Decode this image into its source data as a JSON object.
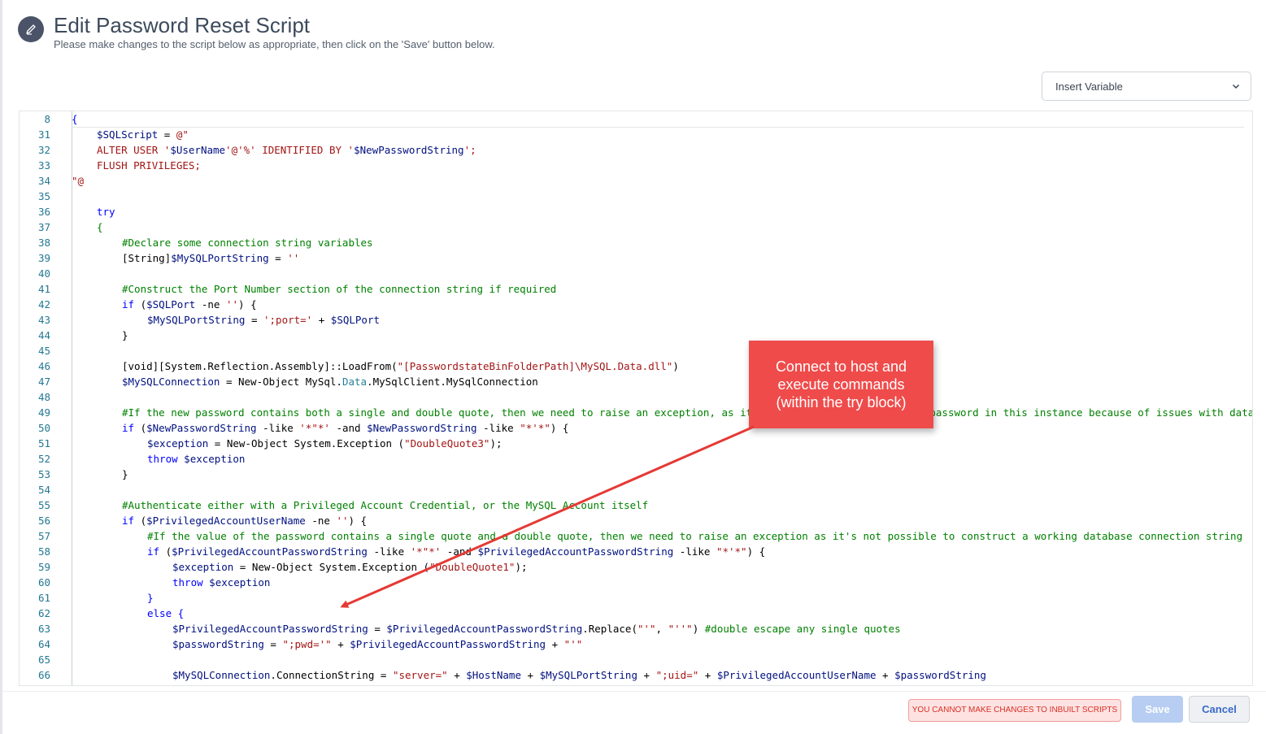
{
  "header": {
    "title": "Edit Password Reset Script",
    "subtitle": "Please make changes to the script below as appropriate, then click on the 'Save' button below."
  },
  "insert_variable": {
    "label": "Insert Variable"
  },
  "editor": {
    "lines": [
      {
        "n": "8",
        "indent": 0,
        "tokens": [
          {
            "t": "{",
            "c": "kw"
          }
        ]
      },
      {
        "n": "31",
        "indent": 1,
        "tokens": [
          {
            "t": "$SQLScript",
            "c": "var"
          },
          {
            "t": " = ",
            "c": ""
          },
          {
            "t": "@\"",
            "c": "str"
          }
        ]
      },
      {
        "n": "32",
        "indent": 1,
        "tokens": [
          {
            "t": "ALTER USER '",
            "c": "str"
          },
          {
            "t": "$UserName",
            "c": "var"
          },
          {
            "t": "'@'%' IDENTIFIED BY '",
            "c": "str"
          },
          {
            "t": "$NewPasswordString",
            "c": "var"
          },
          {
            "t": "';",
            "c": "str"
          }
        ]
      },
      {
        "n": "33",
        "indent": 1,
        "tokens": [
          {
            "t": "FLUSH PRIVILEGES;",
            "c": "str"
          }
        ]
      },
      {
        "n": "34",
        "indent": 0,
        "tokens": [
          {
            "t": "\"@",
            "c": "str"
          }
        ]
      },
      {
        "n": "35",
        "indent": 0,
        "tokens": []
      },
      {
        "n": "36",
        "indent": 1,
        "tokens": [
          {
            "t": "try",
            "c": "kw"
          }
        ]
      },
      {
        "n": "37",
        "indent": 1,
        "tokens": [
          {
            "t": "{",
            "c": "cm"
          }
        ]
      },
      {
        "n": "38",
        "indent": 2,
        "tokens": [
          {
            "t": "#Declare some connection string variables",
            "c": "cm"
          }
        ]
      },
      {
        "n": "39",
        "indent": 2,
        "tokens": [
          {
            "t": "[String]",
            "c": ""
          },
          {
            "t": "$MySQLPortString",
            "c": "var"
          },
          {
            "t": " = ",
            "c": ""
          },
          {
            "t": "''",
            "c": "str"
          }
        ]
      },
      {
        "n": "40",
        "indent": 0,
        "tokens": []
      },
      {
        "n": "41",
        "indent": 2,
        "tokens": [
          {
            "t": "#Construct the Port Number section of the connection string if required",
            "c": "cm"
          }
        ]
      },
      {
        "n": "42",
        "indent": 2,
        "tokens": [
          {
            "t": "if",
            "c": "kw"
          },
          {
            "t": " (",
            "c": ""
          },
          {
            "t": "$SQLPort",
            "c": "var"
          },
          {
            "t": " -ne ",
            "c": ""
          },
          {
            "t": "''",
            "c": "str"
          },
          {
            "t": ") {",
            "c": ""
          }
        ]
      },
      {
        "n": "43",
        "indent": 3,
        "tokens": [
          {
            "t": "$MySQLPortString",
            "c": "var"
          },
          {
            "t": " = ",
            "c": ""
          },
          {
            "t": "';port='",
            "c": "str"
          },
          {
            "t": " + ",
            "c": ""
          },
          {
            "t": "$SQLPort",
            "c": "var"
          }
        ]
      },
      {
        "n": "44",
        "indent": 2,
        "tokens": [
          {
            "t": "}",
            "c": ""
          }
        ]
      },
      {
        "n": "45",
        "indent": 0,
        "tokens": []
      },
      {
        "n": "46",
        "indent": 2,
        "tokens": [
          {
            "t": "[void][System.Reflection.Assembly]::LoadFrom(",
            "c": ""
          },
          {
            "t": "\"[PasswordstateBinFolderPath]\\MySQL.Data.dll\"",
            "c": "str"
          },
          {
            "t": ")",
            "c": ""
          }
        ]
      },
      {
        "n": "47",
        "indent": 2,
        "tokens": [
          {
            "t": "$MySQLConnection",
            "c": "var"
          },
          {
            "t": " = New-Object MySql.",
            "c": ""
          },
          {
            "t": "Data",
            "c": "tp"
          },
          {
            "t": ".MySqlClient.MySqlConnection",
            "c": ""
          }
        ]
      },
      {
        "n": "48",
        "indent": 0,
        "tokens": []
      },
      {
        "n": "49",
        "indent": 2,
        "tokens": [
          {
            "t": "#If the new password contains both a single and double quote, then we need to raise an exception, as it's not possible to reset the password in this instance because of issues with database connection strings",
            "c": "cm"
          }
        ]
      },
      {
        "n": "50",
        "indent": 2,
        "tokens": [
          {
            "t": "if",
            "c": "kw"
          },
          {
            "t": " (",
            "c": ""
          },
          {
            "t": "$NewPasswordString",
            "c": "var"
          },
          {
            "t": " -like ",
            "c": ""
          },
          {
            "t": "'*\"*'",
            "c": "str"
          },
          {
            "t": " -and ",
            "c": ""
          },
          {
            "t": "$NewPasswordString",
            "c": "var"
          },
          {
            "t": " -like ",
            "c": ""
          },
          {
            "t": "\"*'*\"",
            "c": "str"
          },
          {
            "t": ") {",
            "c": ""
          }
        ]
      },
      {
        "n": "51",
        "indent": 3,
        "tokens": [
          {
            "t": "$exception",
            "c": "var"
          },
          {
            "t": " = New-Object System.Exception (",
            "c": ""
          },
          {
            "t": "\"DoubleQuote3\"",
            "c": "str"
          },
          {
            "t": ");",
            "c": ""
          }
        ]
      },
      {
        "n": "52",
        "indent": 3,
        "tokens": [
          {
            "t": "throw",
            "c": "kw"
          },
          {
            "t": " ",
            "c": ""
          },
          {
            "t": "$exception",
            "c": "var"
          }
        ]
      },
      {
        "n": "53",
        "indent": 2,
        "tokens": [
          {
            "t": "}",
            "c": ""
          }
        ]
      },
      {
        "n": "54",
        "indent": 0,
        "tokens": []
      },
      {
        "n": "55",
        "indent": 2,
        "tokens": [
          {
            "t": "#Authenticate either with a Privileged Account Credential, or the MySQL Account itself",
            "c": "cm"
          }
        ]
      },
      {
        "n": "56",
        "indent": 2,
        "tokens": [
          {
            "t": "if",
            "c": "kw"
          },
          {
            "t": " (",
            "c": ""
          },
          {
            "t": "$PrivilegedAccountUserName",
            "c": "var"
          },
          {
            "t": " -ne ",
            "c": ""
          },
          {
            "t": "''",
            "c": "str"
          },
          {
            "t": ") {",
            "c": ""
          }
        ]
      },
      {
        "n": "57",
        "indent": 3,
        "tokens": [
          {
            "t": "#If the value of the password contains a single quote and a double quote, then we need to raise an exception as it's not possible to construct a working database connection string",
            "c": "cm"
          }
        ]
      },
      {
        "n": "58",
        "indent": 3,
        "tokens": [
          {
            "t": "if",
            "c": "kw"
          },
          {
            "t": " (",
            "c": ""
          },
          {
            "t": "$PrivilegedAccountPasswordString",
            "c": "var"
          },
          {
            "t": " -like ",
            "c": ""
          },
          {
            "t": "'*\"*'",
            "c": "str"
          },
          {
            "t": " -and ",
            "c": ""
          },
          {
            "t": "$PrivilegedAccountPasswordString",
            "c": "var"
          },
          {
            "t": " -like ",
            "c": ""
          },
          {
            "t": "\"*'*\"",
            "c": "str"
          },
          {
            "t": ") {",
            "c": ""
          }
        ]
      },
      {
        "n": "59",
        "indent": 4,
        "tokens": [
          {
            "t": "$exception",
            "c": "var"
          },
          {
            "t": " = New-Object System.Exception (",
            "c": ""
          },
          {
            "t": "\"DoubleQuote1\"",
            "c": "str"
          },
          {
            "t": ");",
            "c": ""
          }
        ]
      },
      {
        "n": "60",
        "indent": 4,
        "tokens": [
          {
            "t": "throw",
            "c": "kw"
          },
          {
            "t": " ",
            "c": ""
          },
          {
            "t": "$exception",
            "c": "var"
          }
        ]
      },
      {
        "n": "61",
        "indent": 3,
        "tokens": [
          {
            "t": "}",
            "c": "kw"
          }
        ]
      },
      {
        "n": "62",
        "indent": 3,
        "tokens": [
          {
            "t": "else",
            "c": "kw"
          },
          {
            "t": " {",
            "c": "kw"
          }
        ]
      },
      {
        "n": "63",
        "indent": 4,
        "tokens": [
          {
            "t": "$PrivilegedAccountPasswordString",
            "c": "var"
          },
          {
            "t": " = ",
            "c": ""
          },
          {
            "t": "$PrivilegedAccountPasswordString",
            "c": "var"
          },
          {
            "t": ".Replace(",
            "c": ""
          },
          {
            "t": "\"'\"",
            "c": "str"
          },
          {
            "t": ", ",
            "c": ""
          },
          {
            "t": "\"''\"",
            "c": "str"
          },
          {
            "t": ") ",
            "c": ""
          },
          {
            "t": "#double escape any single quotes",
            "c": "cm"
          }
        ]
      },
      {
        "n": "64",
        "indent": 4,
        "tokens": [
          {
            "t": "$passwordString",
            "c": "var"
          },
          {
            "t": " = ",
            "c": ""
          },
          {
            "t": "\";pwd='\"",
            "c": "str"
          },
          {
            "t": " + ",
            "c": ""
          },
          {
            "t": "$PrivilegedAccountPasswordString",
            "c": "var"
          },
          {
            "t": " + ",
            "c": ""
          },
          {
            "t": "\"'\"",
            "c": "str"
          }
        ]
      },
      {
        "n": "65",
        "indent": 0,
        "tokens": []
      },
      {
        "n": "66",
        "indent": 4,
        "tokens": [
          {
            "t": "$MySQLConnection",
            "c": "var"
          },
          {
            "t": ".ConnectionString = ",
            "c": ""
          },
          {
            "t": "\"server=\"",
            "c": "str"
          },
          {
            "t": " + ",
            "c": ""
          },
          {
            "t": "$HostName",
            "c": "var"
          },
          {
            "t": " + ",
            "c": ""
          },
          {
            "t": "$MySQLPortString",
            "c": "var"
          },
          {
            "t": " + ",
            "c": ""
          },
          {
            "t": "\";uid=\"",
            "c": "str"
          },
          {
            "t": " + ",
            "c": ""
          },
          {
            "t": "$PrivilegedAccountUserName",
            "c": "var"
          },
          {
            "t": " + ",
            "c": ""
          },
          {
            "t": "$passwordString",
            "c": "var"
          }
        ]
      }
    ]
  },
  "callout": {
    "text": "Connect to host and execute commands (within the try block)"
  },
  "footer": {
    "warning": "YOU CANNOT MAKE CHANGES TO INBUILT SCRIPTS",
    "save_label": "Save",
    "cancel_label": "Cancel"
  },
  "colors": {
    "callout": "#ef4b4b",
    "keyword": "#0000ff",
    "variable": "#001080",
    "string": "#a31515",
    "comment": "#008000"
  }
}
